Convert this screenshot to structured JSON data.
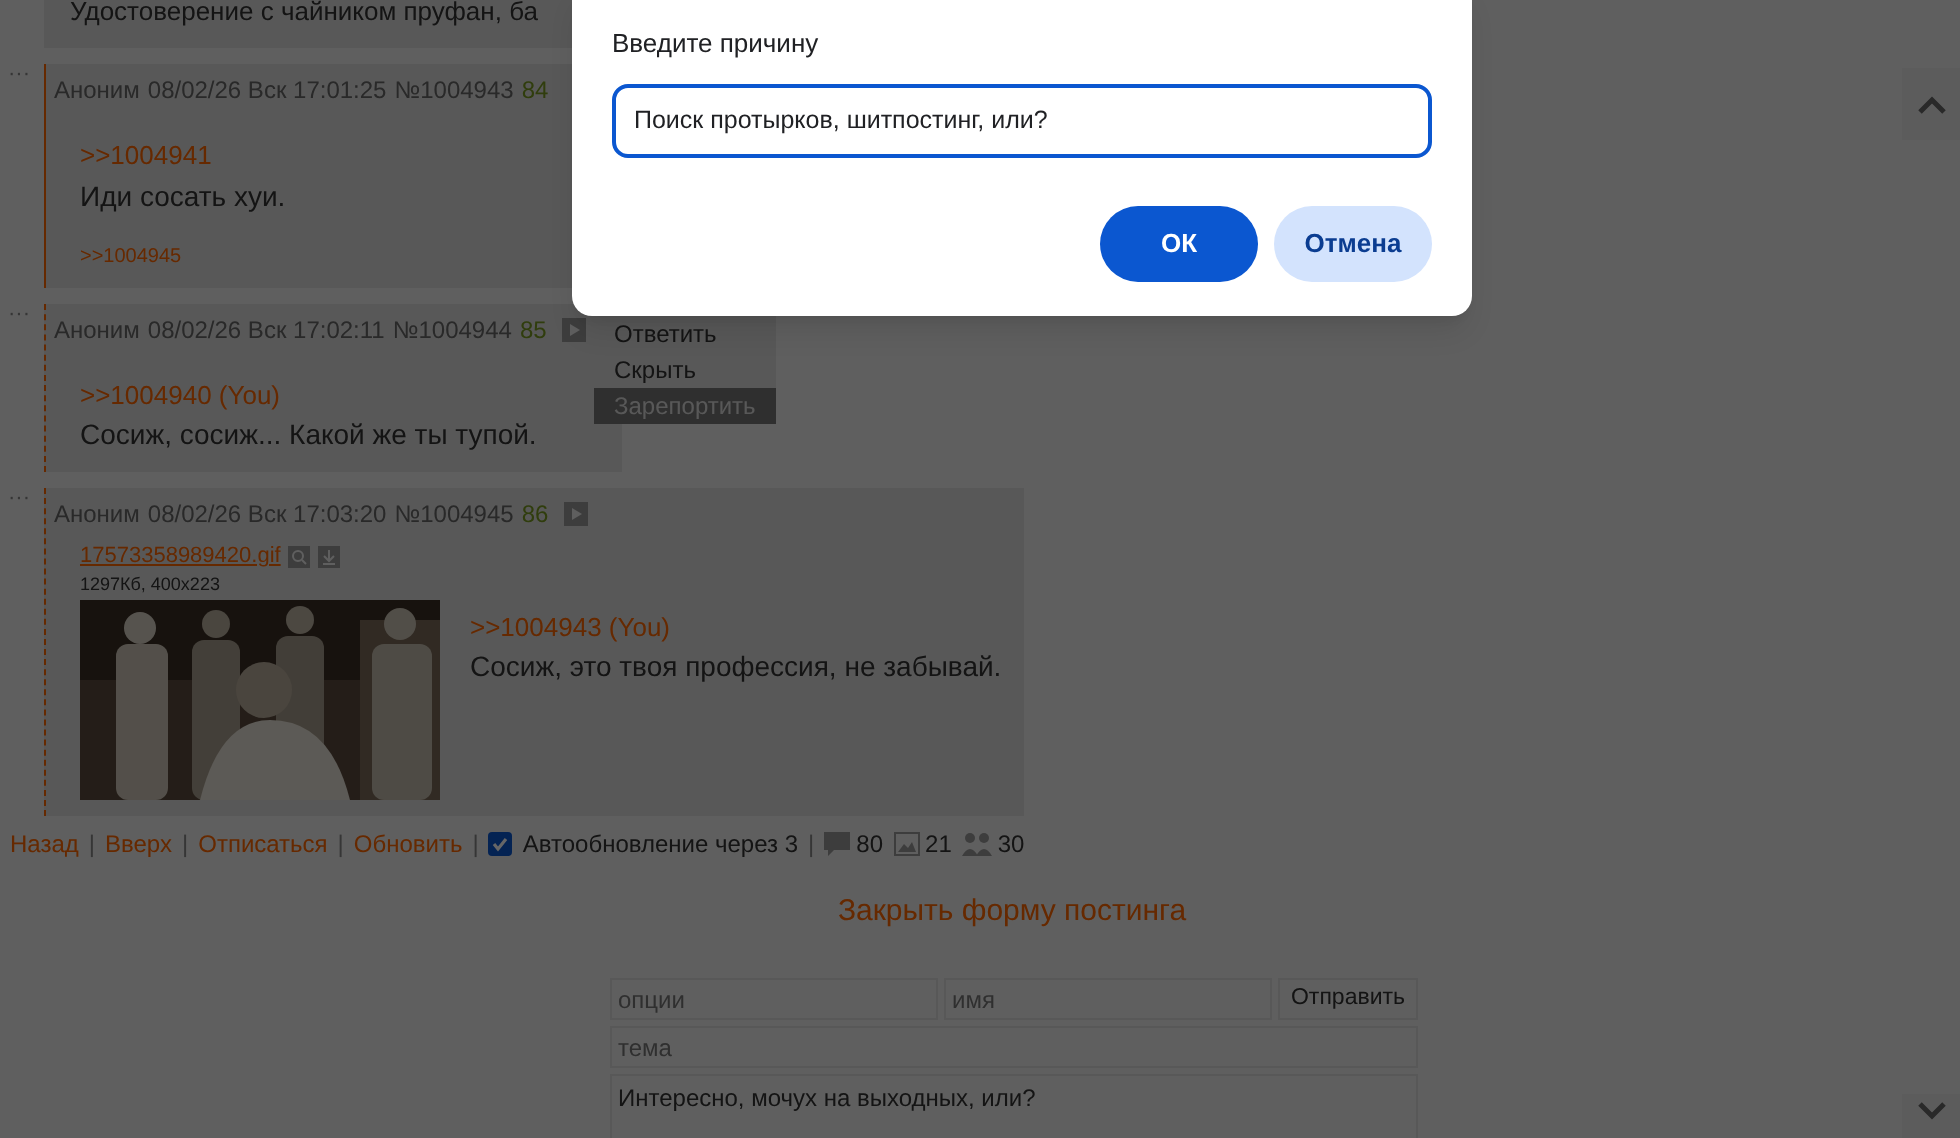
{
  "top_post_fragment": {
    "text": "Удостоверение с чайником пруфан, ба"
  },
  "posts": [
    {
      "author": "Аноним",
      "date": "08/02/26 Вск 17:01:25",
      "number": "№1004943",
      "counter": "84",
      "highlighted": true,
      "reply_link": ">>1004941",
      "text": "Иди сосать хуи.",
      "replies": [
        ">>1004945"
      ]
    },
    {
      "author": "Аноним",
      "date": "08/02/26 Вск 17:02:11",
      "number": "№1004944",
      "counter": "85",
      "highlighted": false,
      "reply_link": ">>1004940 (You)",
      "text": "Сосиж, сосиж... Какой же ты тупой."
    },
    {
      "author": "Аноним",
      "date": "08/02/26 Вск 17:03:20",
      "number": "№1004945",
      "counter": "86",
      "highlighted": false,
      "file": {
        "name": "17573358989420.gif",
        "meta": "1297Кб, 400x223",
        "kind": "picture"
      },
      "reply_link": ">>1004943 (You)",
      "text": "Сосиж, это твоя профессия, не забывай."
    }
  ],
  "context_menu": [
    {
      "label": "Ответить",
      "selected": false
    },
    {
      "label": "Скрыть",
      "selected": false
    },
    {
      "label": "Зарепортить",
      "selected": true
    }
  ],
  "post_menu_glyph": "···",
  "thread_nav": {
    "separator": "|",
    "links": [
      "Назад",
      "Вверх",
      "Отписаться",
      "Обновить"
    ],
    "autoupdate": {
      "label": "Автообновление через 3",
      "checked": true
    },
    "stats": [
      {
        "kind": "posts",
        "value": "80"
      },
      {
        "kind": "images",
        "value": "21"
      },
      {
        "kind": "posters",
        "value": "30"
      }
    ]
  },
  "posting_form": {
    "toggle": "Закрыть форму постинга",
    "options_placeholder": "опции",
    "name_placeholder": "имя",
    "submit": "Отправить",
    "subject_placeholder": "тема",
    "comment": "Интересно, мочух на выходных, или?"
  },
  "dialog": {
    "label": "Введите причину",
    "value": "Поиск протырков, шитпостинг, или?",
    "buttons": [
      {
        "label": "ОК",
        "kind": "primary"
      },
      {
        "label": "Отмена",
        "kind": "secondary"
      }
    ]
  }
}
